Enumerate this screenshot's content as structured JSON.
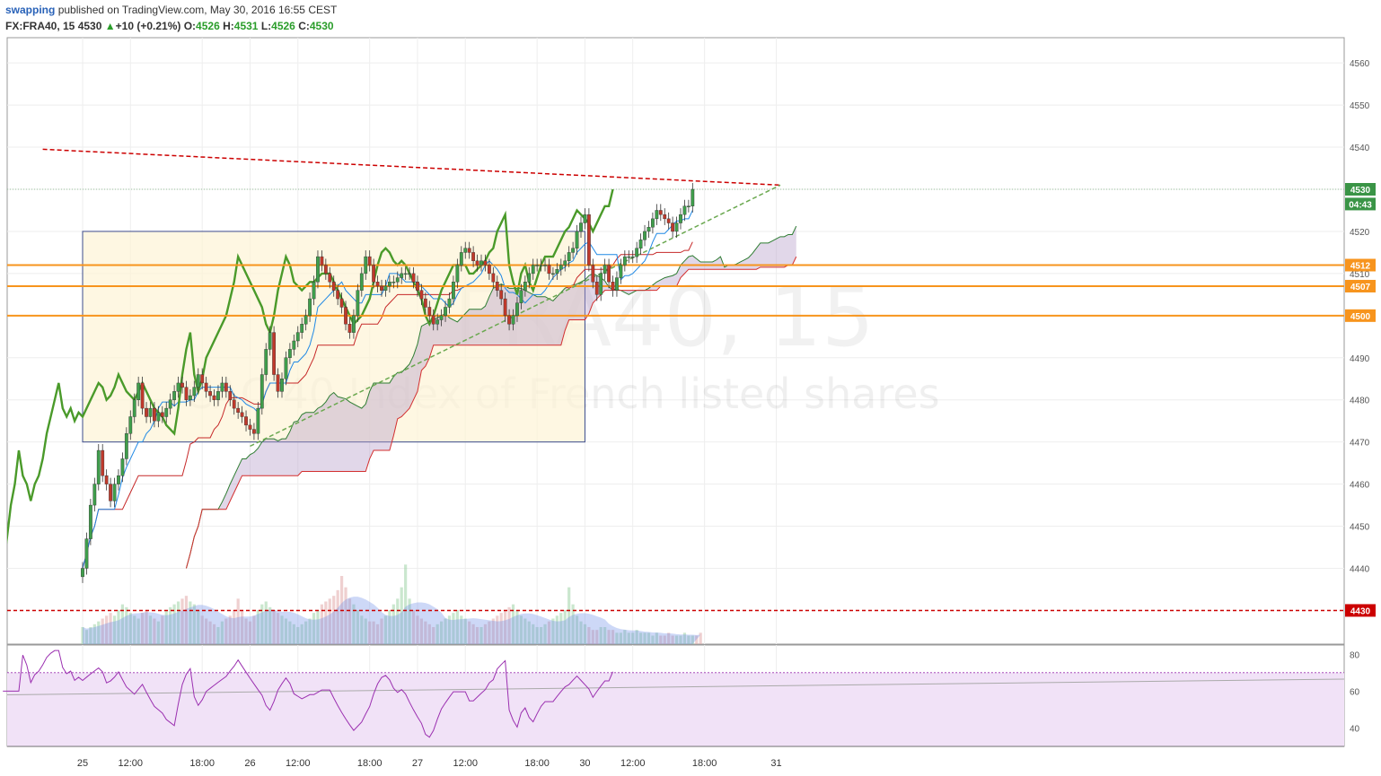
{
  "header": {
    "author": "swapping",
    "published_text": "published on TradingView.com, May 30, 2016 16:55 CEST",
    "symbol": "FX:FRA40, 15",
    "last": "4530",
    "arrow": "▲",
    "change": "+10 (+0.21%)",
    "o_label": "O:",
    "o": "4526",
    "h_label": "H:",
    "h": "4531",
    "l_label": "L:",
    "l": "4526",
    "c_label": "C:",
    "c": "4530"
  },
  "watermark": {
    "symbol": "FRA40, 15",
    "description": "CAC 40 Index of French listed shares"
  },
  "colors": {
    "up": "#3f9e4b",
    "down": "#c0392b",
    "price_tag": "#3a9446",
    "orange": "#f7941d",
    "red_level": "#cc0000",
    "cloud": "#b59cc8",
    "rsi": "#9b30b0",
    "rsi_bg": "#f1e2f7",
    "lagging": "#4a9a2a"
  },
  "chart_data": [
    {
      "type": "candlestick",
      "title": "FX:FRA40, 15",
      "ylim": [
        4422,
        4566
      ],
      "yticks": [
        4440,
        4450,
        4460,
        4470,
        4480,
        4490,
        4500,
        4510,
        4520,
        4530,
        4540,
        4550,
        4560
      ],
      "xticks": [
        {
          "label": "25",
          "bar": 0
        },
        {
          "label": "12:00",
          "bar": 12
        },
        {
          "label": "18:00",
          "bar": 30
        },
        {
          "label": "26",
          "bar": 42
        },
        {
          "label": "12:00",
          "bar": 54
        },
        {
          "label": "18:00",
          "bar": 72
        },
        {
          "label": "27",
          "bar": 84
        },
        {
          "label": "12:00",
          "bar": 96
        },
        {
          "label": "18:00",
          "bar": 114
        },
        {
          "label": "30",
          "bar": 126
        },
        {
          "label": "12:00",
          "bar": 138
        },
        {
          "label": "18:00",
          "bar": 156
        },
        {
          "label": "31",
          "bar": 174
        }
      ],
      "price_tags": [
        {
          "label": "4530",
          "value": 4530,
          "color": "#3a9446"
        },
        {
          "label": "04:43",
          "value": 4526.5,
          "color": "#3a9446"
        },
        {
          "label": "4512",
          "value": 4512,
          "color": "#f7941d"
        },
        {
          "label": "4507",
          "value": 4507,
          "color": "#f7941d"
        },
        {
          "label": "4500",
          "value": 4500,
          "color": "#f7941d"
        },
        {
          "label": "4430",
          "value": 4430,
          "color": "#cc0000"
        }
      ],
      "horizontal_levels": [
        4512,
        4507,
        4500
      ],
      "support_level": 4430,
      "resistance_line": {
        "from": {
          "bar": -10,
          "value": 4539.5
        },
        "to": {
          "bar": 175,
          "value": 4531
        }
      },
      "trend_line": {
        "from": {
          "bar": 42,
          "value": 4469
        },
        "to": {
          "bar": 175,
          "value": 4531
        }
      },
      "range_box": {
        "from_bar": 0,
        "to_bar": 126,
        "top": 4520,
        "bottom": 4470
      },
      "closes": [
        4440,
        4447,
        4455,
        4460,
        4468,
        4462,
        4460,
        4456,
        4460,
        4462,
        4466,
        4472,
        4476,
        4480,
        4484,
        4478,
        4476,
        4478,
        4475,
        4477,
        4476,
        4478,
        4480,
        4482,
        4484,
        4483,
        4480,
        4481,
        4483,
        4486,
        4484,
        4482,
        4481,
        4480,
        4482,
        4484,
        4482,
        4480,
        4478,
        4477,
        4476,
        4474,
        4473,
        4472,
        4478,
        4486,
        4492,
        4496,
        4486,
        4482,
        4485,
        4490,
        4492,
        4494,
        4496,
        4498,
        4500,
        4504,
        4508,
        4514,
        4512,
        4510,
        4508,
        4506,
        4504,
        4502,
        4498,
        4496,
        4500,
        4506,
        4510,
        4514,
        4512,
        4508,
        4507,
        4506,
        4507,
        4508,
        4508,
        4509,
        4510,
        4510,
        4510,
        4508,
        4506,
        4504,
        4502,
        4500,
        4498,
        4499,
        4500,
        4502,
        4504,
        4508,
        4512,
        4515,
        4516,
        4515,
        4513,
        4512,
        4513,
        4512,
        4510,
        4508,
        4506,
        4504,
        4500,
        4498,
        4500,
        4503,
        4506,
        4508,
        4510,
        4512,
        4512,
        4512,
        4512,
        4510,
        4510,
        4511,
        4512,
        4513,
        4515,
        4516,
        4520,
        4522,
        4524,
        4512,
        4508,
        4505,
        4510,
        4512,
        4508,
        4506,
        4509,
        4512,
        4514,
        4514,
        4514,
        4516,
        4518,
        4520,
        4521,
        4523,
        4525,
        4524,
        4523,
        4522,
        4520,
        4522,
        4524,
        4526,
        4526,
        4530
      ],
      "volumes": [
        6,
        5,
        6,
        7,
        8,
        9,
        10,
        11,
        10,
        12,
        14,
        13,
        11,
        10,
        9,
        11,
        12,
        10,
        9,
        8,
        10,
        12,
        13,
        14,
        15,
        16,
        17,
        15,
        14,
        12,
        10,
        9,
        8,
        7,
        6,
        8,
        9,
        10,
        12,
        16,
        12,
        9,
        8,
        10,
        12,
        14,
        15,
        13,
        12,
        11,
        10,
        9,
        8,
        7,
        6,
        7,
        8,
        9,
        11,
        12,
        14,
        15,
        16,
        17,
        19,
        24,
        20,
        16,
        14,
        12,
        10,
        9,
        8,
        8,
        7,
        9,
        10,
        12,
        14,
        16,
        20,
        28,
        16,
        12,
        10,
        9,
        8,
        7,
        6,
        7,
        8,
        9,
        10,
        11,
        12,
        10,
        9,
        8,
        7,
        6,
        6,
        7,
        8,
        9,
        10,
        11,
        12,
        13,
        14,
        12,
        10,
        9,
        8,
        7,
        6,
        6,
        7,
        8,
        9,
        10,
        11,
        12,
        20,
        14,
        10,
        8,
        7,
        6,
        5,
        5,
        6,
        6,
        5,
        5,
        4,
        4,
        5,
        4,
        4,
        5,
        4,
        4,
        4,
        3,
        4,
        3,
        3,
        4,
        3,
        3,
        3,
        4,
        3,
        3,
        3,
        4
      ],
      "rsi": {
        "ylim": [
          30,
          85
        ],
        "yticks": [
          40,
          60,
          80
        ],
        "overbought": 70,
        "oversold": 30
      },
      "ichimoku_cloud": true
    }
  ]
}
